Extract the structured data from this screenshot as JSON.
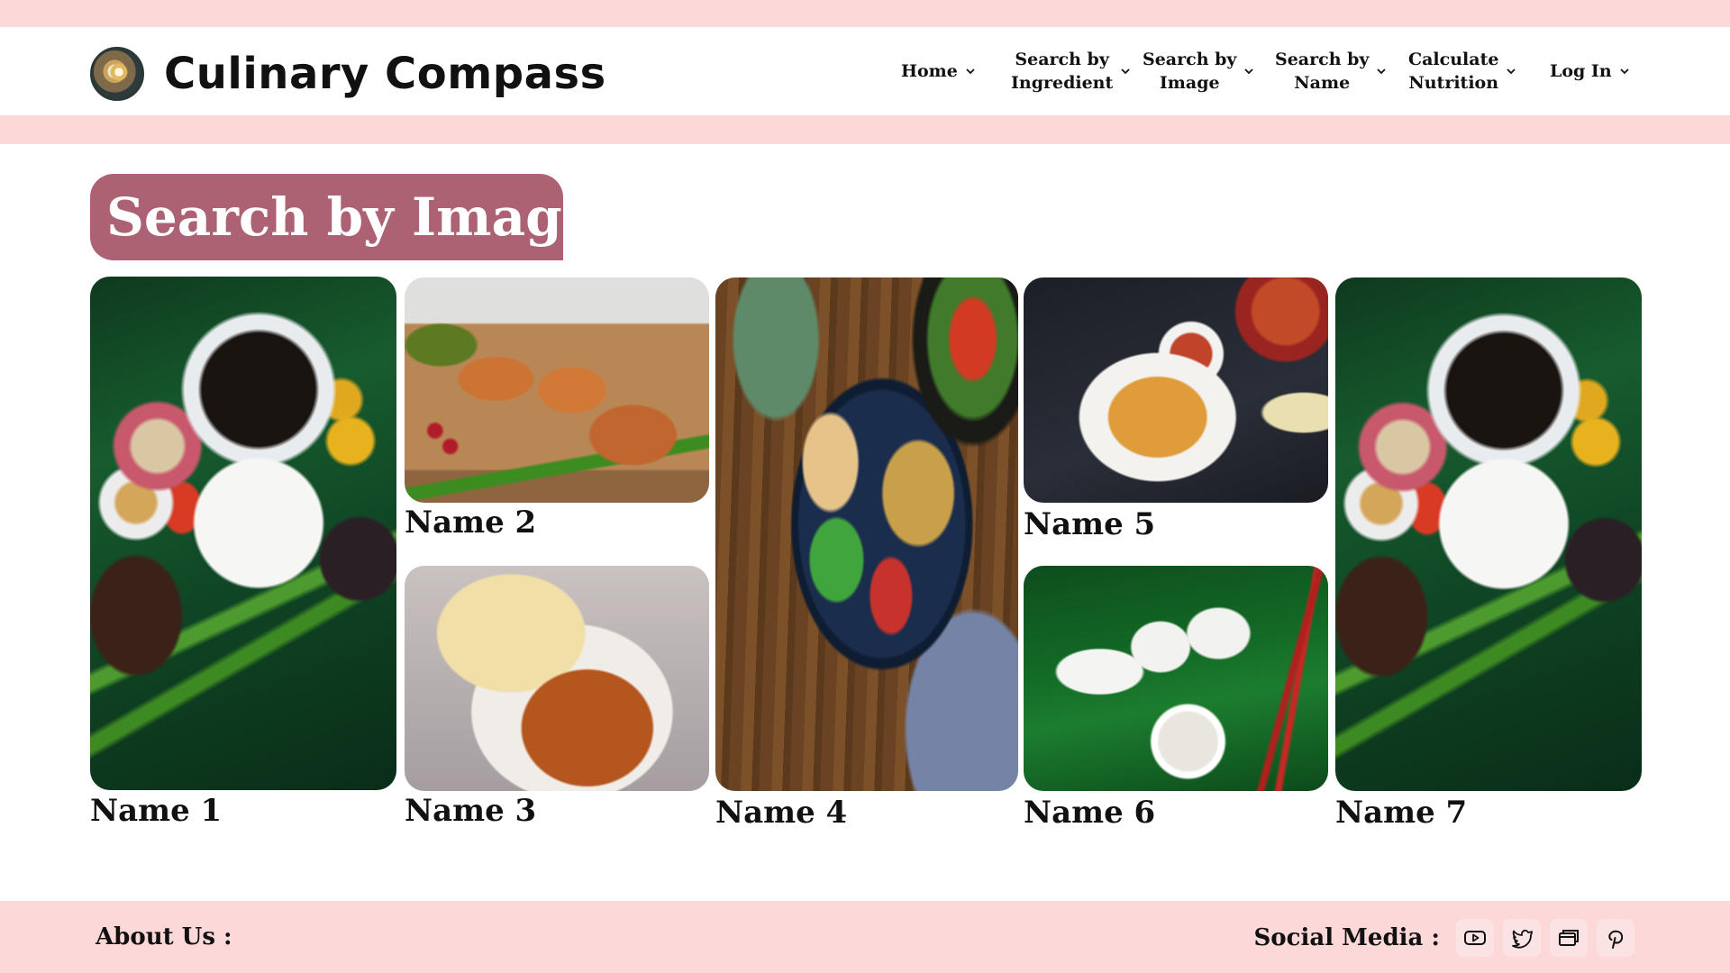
{
  "brand": {
    "name": "Culinary Compass",
    "logo_icon": "plate-icon"
  },
  "nav": {
    "items": [
      {
        "label": "Home"
      },
      {
        "label": "Search by Ingredient",
        "line1": "Search by",
        "line2": "Ingredient"
      },
      {
        "label": "Search by Image",
        "line1": "Search by",
        "line2": "Image"
      },
      {
        "label": "Search by Name",
        "line1": "Search by",
        "line2": "Name"
      },
      {
        "label": "Calculate Nutrition",
        "line1": "Calculate",
        "line2": "Nutrition"
      },
      {
        "label": "Log In"
      }
    ]
  },
  "page": {
    "title": "Search by Image :"
  },
  "results": [
    {
      "name": "Name 1"
    },
    {
      "name": "Name 2"
    },
    {
      "name": "Name 3"
    },
    {
      "name": "Name 4"
    },
    {
      "name": "Name 5"
    },
    {
      "name": "Name 6"
    },
    {
      "name": "Name 7"
    }
  ],
  "footer": {
    "about_label": "About Us :",
    "social_label": "Social Media :",
    "social_icons": [
      "youtube-icon",
      "twitter-icon",
      "browser-icon",
      "pinterest-icon"
    ]
  },
  "colors": {
    "pink_band": "#fdd8d8",
    "title_bg": "#ad6274",
    "title_text": "#ffffff",
    "text": "#111111"
  }
}
